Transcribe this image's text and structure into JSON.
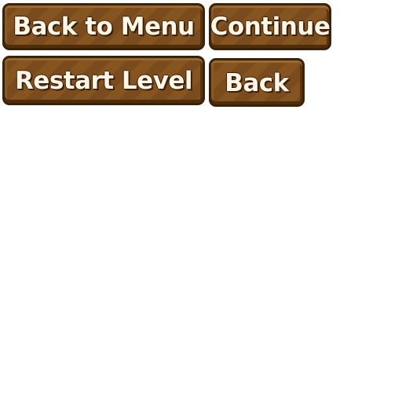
{
  "buttons": {
    "back_to_menu": "Back to Menu",
    "continue": "Continue",
    "restart_level": "Restart Level",
    "back": "Back"
  },
  "colors": {
    "button_fill": "#7a4b1c",
    "button_stripe": "#85541f",
    "button_border": "#3b2108",
    "label_text": "#fff6e8",
    "background": "#ffffff"
  }
}
